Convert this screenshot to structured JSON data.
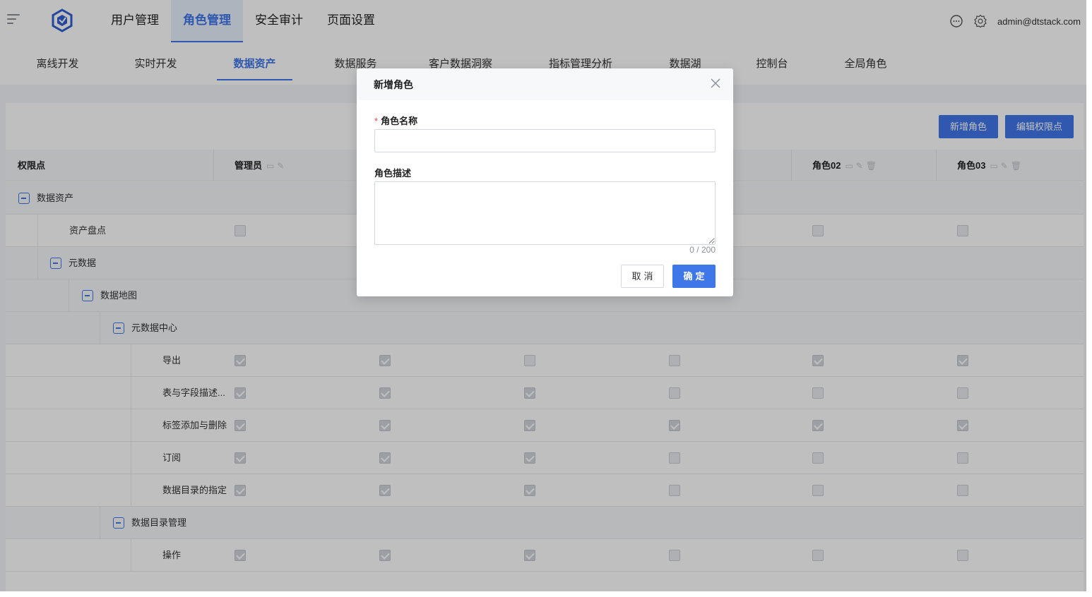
{
  "topbar": {
    "nav": [
      "用户管理",
      "角色管理",
      "安全审计",
      "页面设置"
    ],
    "active_index": 1,
    "user_email": "admin@dtstack.com"
  },
  "subtabs": {
    "items": [
      "离线开发",
      "实时开发",
      "数据资产",
      "数据服务",
      "客户数据洞察",
      "指标管理分析",
      "数据湖",
      "控制台",
      "全局角色"
    ],
    "active_index": 2
  },
  "toolbar": {
    "add_role": "新增角色",
    "edit_permission": "编辑权限点"
  },
  "table": {
    "first_column": "权限点",
    "role_columns": [
      "管理员",
      "",
      "",
      "",
      "角色02",
      "角色03"
    ],
    "rows": [
      {
        "label": "数据资产",
        "type": "group",
        "level": 0
      },
      {
        "label": "资产盘点",
        "type": "leaf",
        "level": 1,
        "checks": [
          false,
          false,
          false,
          false,
          false,
          false
        ]
      },
      {
        "label": "元数据",
        "type": "group",
        "level": 1
      },
      {
        "label": "数据地图",
        "type": "group",
        "level": 2
      },
      {
        "label": "元数据中心",
        "type": "group",
        "level": 3
      },
      {
        "label": "导出",
        "type": "leaf",
        "level": 4,
        "checks": [
          true,
          true,
          false,
          false,
          true,
          true
        ]
      },
      {
        "label": "表与字段描述...",
        "type": "leaf",
        "level": 4,
        "checks": [
          true,
          true,
          true,
          false,
          false,
          false
        ]
      },
      {
        "label": "标签添加与删除",
        "type": "leaf",
        "level": 4,
        "checks": [
          true,
          true,
          true,
          true,
          true,
          true
        ]
      },
      {
        "label": "订阅",
        "type": "leaf",
        "level": 4,
        "checks": [
          true,
          true,
          true,
          false,
          false,
          false
        ]
      },
      {
        "label": "数据目录的指定",
        "type": "leaf",
        "level": 4,
        "checks": [
          true,
          true,
          true,
          false,
          false,
          false
        ]
      },
      {
        "label": "数据目录管理",
        "type": "group",
        "level": 3
      },
      {
        "label": "操作",
        "type": "leaf",
        "level": 4,
        "checks": [
          true,
          true,
          true,
          false,
          false,
          false
        ]
      }
    ]
  },
  "modal": {
    "title": "新增角色",
    "name_label": "角色名称",
    "name_value": "",
    "desc_label": "角色描述",
    "desc_value": "",
    "counter": "0 / 200",
    "cancel": "取消",
    "ok": "确定"
  },
  "colors": {
    "primary": "#3f76e8",
    "required": "#e04b4b"
  }
}
